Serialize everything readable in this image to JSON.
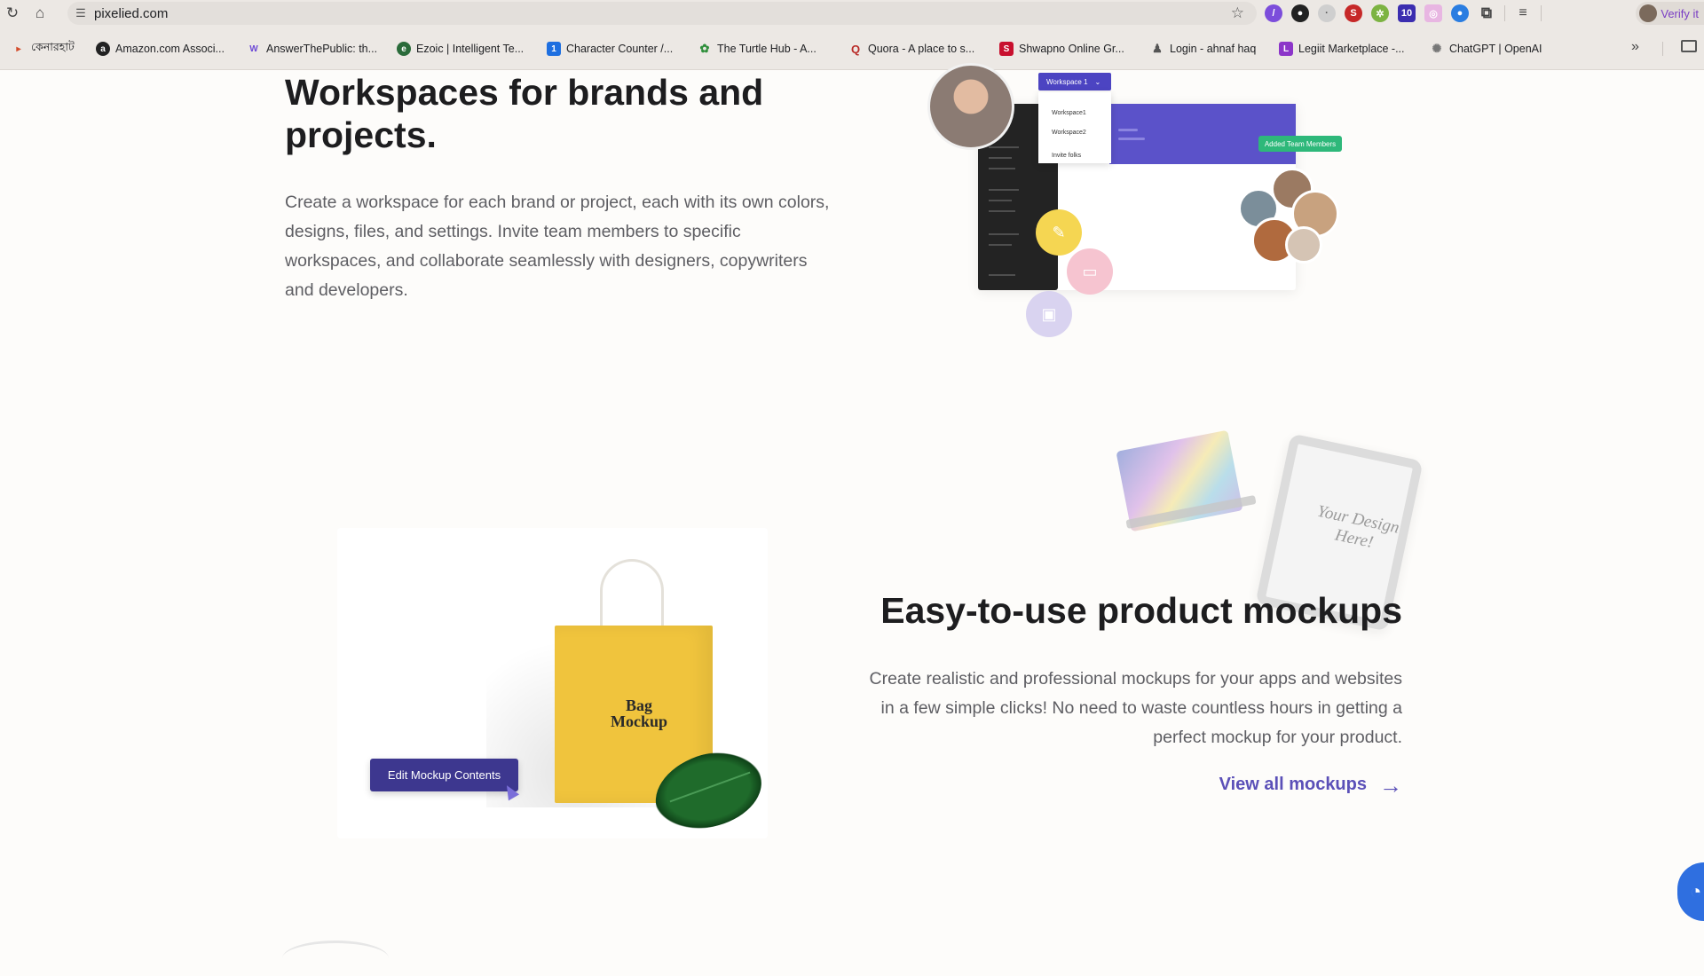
{
  "browser": {
    "url": "pixelied.com",
    "profile_label": "Verify it"
  },
  "bookmarks": [
    {
      "label": "কেনারহাট",
      "icon": "kenarhat-icon",
      "color": "#d44b2a"
    },
    {
      "label": "Amazon.com Associ...",
      "icon": "amazon-icon",
      "color": "#222222"
    },
    {
      "label": "AnswerThePublic: th...",
      "icon": "answerthepublic-icon",
      "color": "#6d4ad6"
    },
    {
      "label": "Ezoic | Intelligent Te...",
      "icon": "ezoic-icon",
      "color": "#2a6b3a"
    },
    {
      "label": "Character Counter /...",
      "icon": "character-counter-icon",
      "color": "#1e6fe0"
    },
    {
      "label": "The Turtle Hub - A...",
      "icon": "turtle-hub-icon",
      "color": "#2f8f3b"
    },
    {
      "label": "Quora - A place to s...",
      "icon": "quora-icon",
      "color": "#b92b27"
    },
    {
      "label": "Shwapno Online Gr...",
      "icon": "shwapno-icon",
      "color": "#c8102e"
    },
    {
      "label": "Login - ahnaf haq",
      "icon": "user-icon",
      "color": "#555555"
    },
    {
      "label": "Legiit Marketplace -...",
      "icon": "legiit-icon",
      "color": "#8c35c9"
    },
    {
      "label": "ChatGPT | OpenAI",
      "icon": "openai-icon",
      "color": "#777777"
    }
  ],
  "section1": {
    "title": "Workspaces for brands and projects.",
    "body": "Create a workspace for each brand or project, each with its own colors, designs, files, and settings. Invite team members to specific workspaces, and collaborate seamlessly with designers, copywriters and developers.",
    "illustration": {
      "dropdown_label": "Workspace 1",
      "menu_items": [
        "Workspace1",
        "Workspace2",
        "Invite folks"
      ],
      "badge": "Added Team Members"
    }
  },
  "section2": {
    "title": "Easy-to-use product mockups",
    "body": "Create realistic and professional mockups for your apps and websites in a few simple clicks! No need to waste countless hours in getting a perfect mockup for your product.",
    "link_label": "View all mockups",
    "tablet_text": "Your Design Here!",
    "bag_text": "Bag Mockup",
    "edit_button_label": "Edit Mockup Contents"
  },
  "colors": {
    "accent_purple": "#5b50b8",
    "badge_green": "#2eb87a",
    "bag_yellow": "#f0c43d",
    "chat_blue": "#2f6fe0"
  }
}
